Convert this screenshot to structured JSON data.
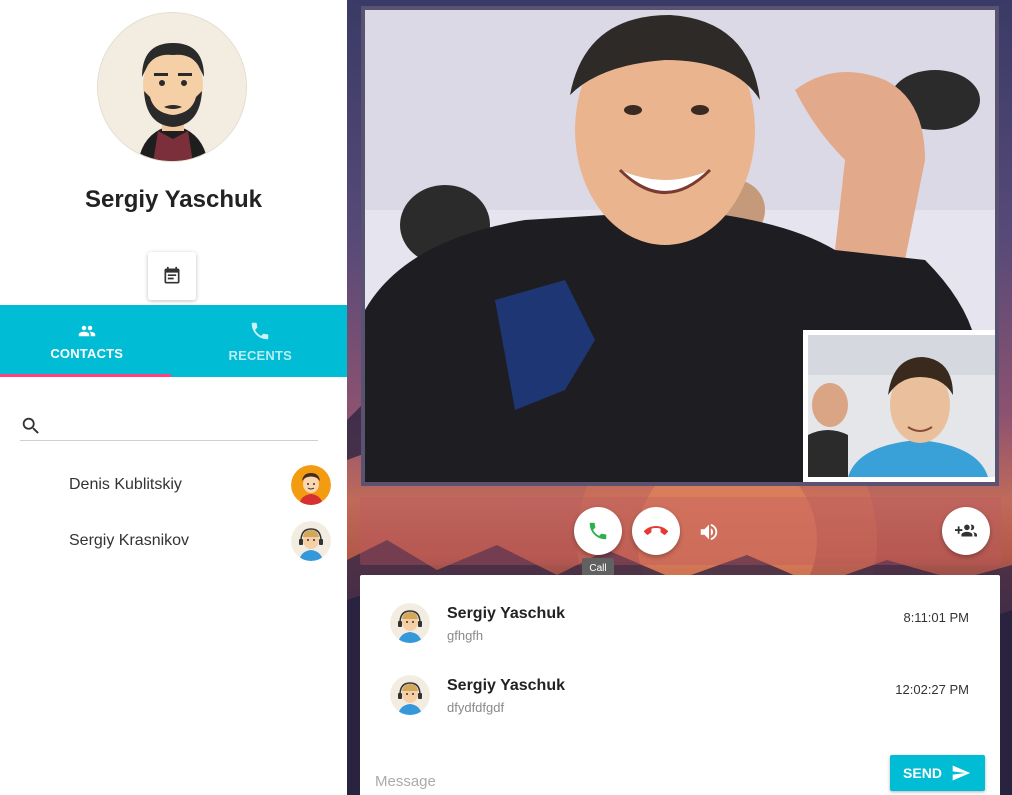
{
  "profile": {
    "name": "Sergiy Yaschuk",
    "avatar_icon": "bearded-man-avatar"
  },
  "profile_actions": {
    "calendar_icon": "event-note-icon"
  },
  "tabs": [
    {
      "label": "CONTACTS",
      "icon": "people-icon",
      "active": true
    },
    {
      "label": "RECENTS",
      "icon": "phone-icon",
      "active": false
    }
  ],
  "search": {
    "placeholder": "",
    "icon": "search-icon"
  },
  "contacts": [
    {
      "name": "Denis Kublitskiy",
      "avatar_icon": "cartoon-boy-avatar"
    },
    {
      "name": "Sergiy Krasnikov",
      "avatar_icon": "headset-avatar"
    }
  ],
  "call_controls": {
    "call_icon": "phone-icon",
    "hangup_icon": "call-end-icon",
    "volume_icon": "volume-icon",
    "add_user_icon": "group-add-icon",
    "call_tooltip": "Call"
  },
  "messages": [
    {
      "author": "Sergiy Yaschuk",
      "text": "gfhgfh",
      "time": "8:11:01 PM"
    },
    {
      "author": "Sergiy Yaschuk",
      "text": "dfydfdfgdf",
      "time": "12:02:27 PM"
    }
  ],
  "composer": {
    "placeholder": "Message",
    "send_label": "SEND"
  },
  "colors": {
    "accent": "#00bcd4",
    "tab_indicator": "#ff4081",
    "call_green": "#2bb24c",
    "hangup_red": "#e53935"
  }
}
